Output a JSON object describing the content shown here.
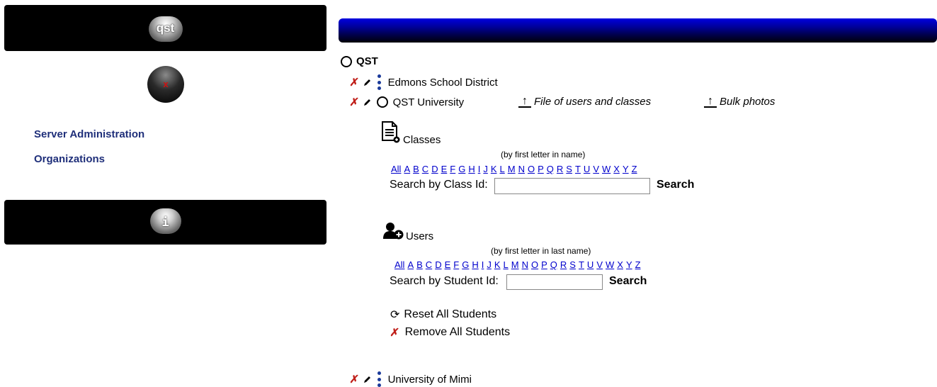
{
  "sidebar": {
    "top_badge": "qst",
    "close_badge": "x",
    "links": [
      "Server Administration",
      "Organizations"
    ],
    "info_badge": "i"
  },
  "tree": {
    "root": "QST",
    "org1": "Edmons School District",
    "org2": "QST University",
    "upload_users": "File of users and classes",
    "upload_photos": "Bulk photos",
    "org3": "University of Mimi"
  },
  "classes": {
    "title": "Classes",
    "note": "(by first letter in name)",
    "search_label": "Search by Class Id:",
    "search_value": "",
    "search_button": "Search"
  },
  "users": {
    "title": "Users",
    "note": "(by first letter in last name)",
    "search_label": "Search by Student Id:",
    "search_value": "",
    "search_button": "Search"
  },
  "letters": [
    "All",
    "A",
    "B",
    "C",
    "D",
    "E",
    "F",
    "G",
    "H",
    "I",
    "J",
    "K",
    "L",
    "M",
    "N",
    "O",
    "P",
    "Q",
    "R",
    "S",
    "T",
    "U",
    "V",
    "W",
    "X",
    "Y",
    "Z"
  ],
  "actions": {
    "reset": "Reset All Students",
    "remove": "Remove All Students"
  },
  "colors": {
    "link": "#1f2f7a",
    "letter_link": "#0000cc",
    "delete": "#c0201b",
    "header_bar_top": "#0000e0",
    "header_bar_bottom": "#000008"
  }
}
